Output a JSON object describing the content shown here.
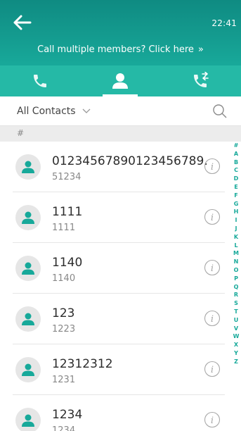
{
  "status": {
    "time": "22:41"
  },
  "banner": {
    "text": "Call multiple members? Click here",
    "chevron": "»"
  },
  "tabs": [
    {
      "name": "calls",
      "icon": "phone-icon",
      "active": false
    },
    {
      "name": "contacts",
      "icon": "contact-icon",
      "active": true
    },
    {
      "name": "transfer",
      "icon": "phone-transfer-icon",
      "active": false
    }
  ],
  "filter": {
    "label": "All Contacts"
  },
  "section": {
    "header": "#"
  },
  "contacts": [
    {
      "name": "01234567890123456789...",
      "number": "51234"
    },
    {
      "name": "1111",
      "number": "1111"
    },
    {
      "name": "1140",
      "number": "1140"
    },
    {
      "name": "123",
      "number": "1223"
    },
    {
      "name": "12312312",
      "number": "1231"
    },
    {
      "name": "1234",
      "number": "1234"
    }
  ],
  "alphabet": [
    "#",
    "A",
    "B",
    "C",
    "D",
    "E",
    "F",
    "G",
    "H",
    "I",
    "J",
    "K",
    "L",
    "M",
    "N",
    "O",
    "P",
    "Q",
    "R",
    "S",
    "T",
    "U",
    "V",
    "W",
    "X",
    "Y",
    "Z"
  ],
  "colors": {
    "header": "#129a8e",
    "tabs": "#25b9a6",
    "accent": "#17a99a"
  }
}
